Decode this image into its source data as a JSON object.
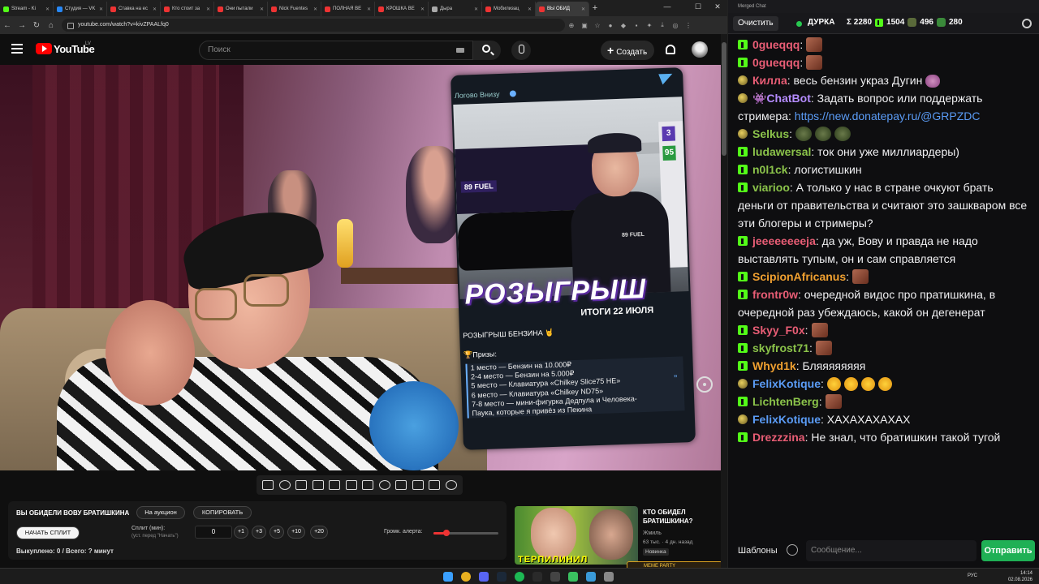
{
  "tabs": [
    {
      "label": "Stream - Ki",
      "color": "#53fc18"
    },
    {
      "label": "Студия — VK",
      "color": "#2787f5"
    },
    {
      "label": "Ставка на ес",
      "color": "#e33"
    },
    {
      "label": "Кто стоит за",
      "color": "#e33"
    },
    {
      "label": "Они пытали",
      "color": "#e33"
    },
    {
      "label": "Nick Fuentes",
      "color": "#e33"
    },
    {
      "label": "ПОЛНАЯ ВЕ",
      "color": "#e33"
    },
    {
      "label": "КРОШКА ВЕ",
      "color": "#e33"
    },
    {
      "label": "Дыра",
      "color": "#aaa"
    },
    {
      "label": "Мобилизац",
      "color": "#e33"
    },
    {
      "label": "ВЫ ОБИД",
      "color": "#e33"
    }
  ],
  "address": {
    "url": "youtube.com/watch?v=kivZPAALfq0"
  },
  "youtube": {
    "logo": "YouTube",
    "region": "LV",
    "search_placeholder": "Поиск",
    "create_label": "Создать"
  },
  "overlay_card": {
    "channel": "Логово Внизу",
    "brand": "89 FUEL",
    "pump_numbers": [
      "3",
      "95"
    ],
    "headline": "РОЗЫГРЫШ",
    "subheadline": "ИТОГИ 22 ИЮЛЯ",
    "intro": "РОЗЫГРЫШ БЕНЗИНА 🤘",
    "prizes_label": "🏆Призы:",
    "prizes": [
      "1 место — Бензин на 10.000₽",
      "2-4 место — Бензин на 5.000₽",
      "5 место — Клавиатура «Chilkey Slice75 HE»",
      "6 место — Клавиатура «Chilkey ND75»",
      "7-8 место — мини-фигурка Дедпула и Человека-",
      "Паука, которые я привёз из Пекина"
    ]
  },
  "panel": {
    "title": "ВЫ ОБИДЕЛИ ВОВУ БРАТИШКИНА",
    "auction_label": "На аукцион",
    "copy_label": "КОПИРОВАТЬ",
    "start_label": "НАЧАТЬ СПЛИТ",
    "split_label": "Сплит (мин):",
    "split_hint": "(уст. перед \"Начать\")",
    "split_value": "0",
    "increments": [
      "+1",
      "+3",
      "+5",
      "+10",
      "+20"
    ],
    "volume_label": "Громк. алерта:",
    "volume_level": 0.2,
    "redeemed": "Выкуплено: 0 / Всего: ? минут"
  },
  "recommended": {
    "title": "КТО ОБИДЕЛ БРАТИШКИНА?",
    "channel": "Жмиль",
    "meta": "63 тыс. · 4 дн. назад",
    "badge": "Новинка",
    "thumb_text": "ТЕРПИЛИНИЛ",
    "meme_label": "MEME PARTY"
  },
  "chat": {
    "window_title": "Merged Chat",
    "clear_label": "Очистить",
    "streamer": "ДУРКА",
    "total": "Σ 2280",
    "kick_count": "1504",
    "other_count": "496",
    "third_count": "280",
    "templates_label": "Шаблоны",
    "input_placeholder": "Сообщение...",
    "send_label": "Отправить",
    "messages": [
      {
        "user": "0gueqqq",
        "color": "#e85d75",
        "text": ":",
        "badge": "kick",
        "emote": "face"
      },
      {
        "user": "0gueqqq",
        "color": "#e85d75",
        "text": ":",
        "badge": "kick",
        "emote": "face"
      },
      {
        "user": "Килла",
        "color": "#e85d75",
        "text": ": весь бензин украз Дугин",
        "badge": "sub",
        "emote": "devil"
      },
      {
        "user": "👾ChatBot",
        "color": "#b58cff",
        "text": ": Задать вопрос или поддержать стримера: ",
        "link": "https://new.donatepay.ru/@GRPZDC",
        "badge": "sub"
      },
      {
        "user": "Selkus",
        "color": "#8bc34a",
        "text": ":",
        "badge": "sub",
        "emote": "green3"
      },
      {
        "user": "ludawersal",
        "color": "#8bc34a",
        "text": ": ток они уже миллиардеры)",
        "badge": "kick"
      },
      {
        "user": "n0l1ck",
        "color": "#8bc34a",
        "text": ": логистишкин",
        "badge": "kick"
      },
      {
        "user": "viarioo",
        "color": "#8bc34a",
        "text": ": А только у нас в стране очкуют брать деньги от правительства и считают это зашкваром все эти блогеры и стримеры?",
        "badge": "kick"
      },
      {
        "user": "jeeeeeeeeja",
        "color": "#e85d75",
        "text": ": да уж, Вову и правда не надо выставлять тупым, он и сам справляется",
        "badge": "kick"
      },
      {
        "user": "ScipionAfricanus",
        "color": "#f0a030",
        "text": ":",
        "badge": "kick",
        "emote": "face"
      },
      {
        "user": "frontr0w",
        "color": "#e85d75",
        "text": ": очередной видос про пратишкина, в очередной раз убеждаюсь, какой он дегенерат",
        "badge": "kick"
      },
      {
        "user": "Skyy_F0x",
        "color": "#e85d75",
        "text": ":",
        "badge": "kick",
        "emote": "face"
      },
      {
        "user": "skyfrost71",
        "color": "#8bc34a",
        "text": ":",
        "badge": "kick",
        "emote": "face"
      },
      {
        "user": "Whyd1k",
        "color": "#f0a030",
        "text": ": Бляяяяяяяя",
        "badge": "kick"
      },
      {
        "user": "FelixKotique",
        "color": "#5b9cf6",
        "text": ":",
        "badge": "sub",
        "emote": "laugh4"
      },
      {
        "user": "LichtenBerg",
        "color": "#8bc34a",
        "text": ":",
        "badge": "kick",
        "emote": "face"
      },
      {
        "user": "FelixKotique",
        "color": "#5b9cf6",
        "text": ": ХАХАХАХАХАХ",
        "badge": "sub"
      },
      {
        "user": "Drezzzina",
        "color": "#e85d75",
        "text": ": Не знал, что братишкин такой тугой",
        "badge": "kick"
      }
    ]
  },
  "taskbar": {
    "lang": "РУС",
    "time": "14:14",
    "date": "02.08.2026"
  }
}
